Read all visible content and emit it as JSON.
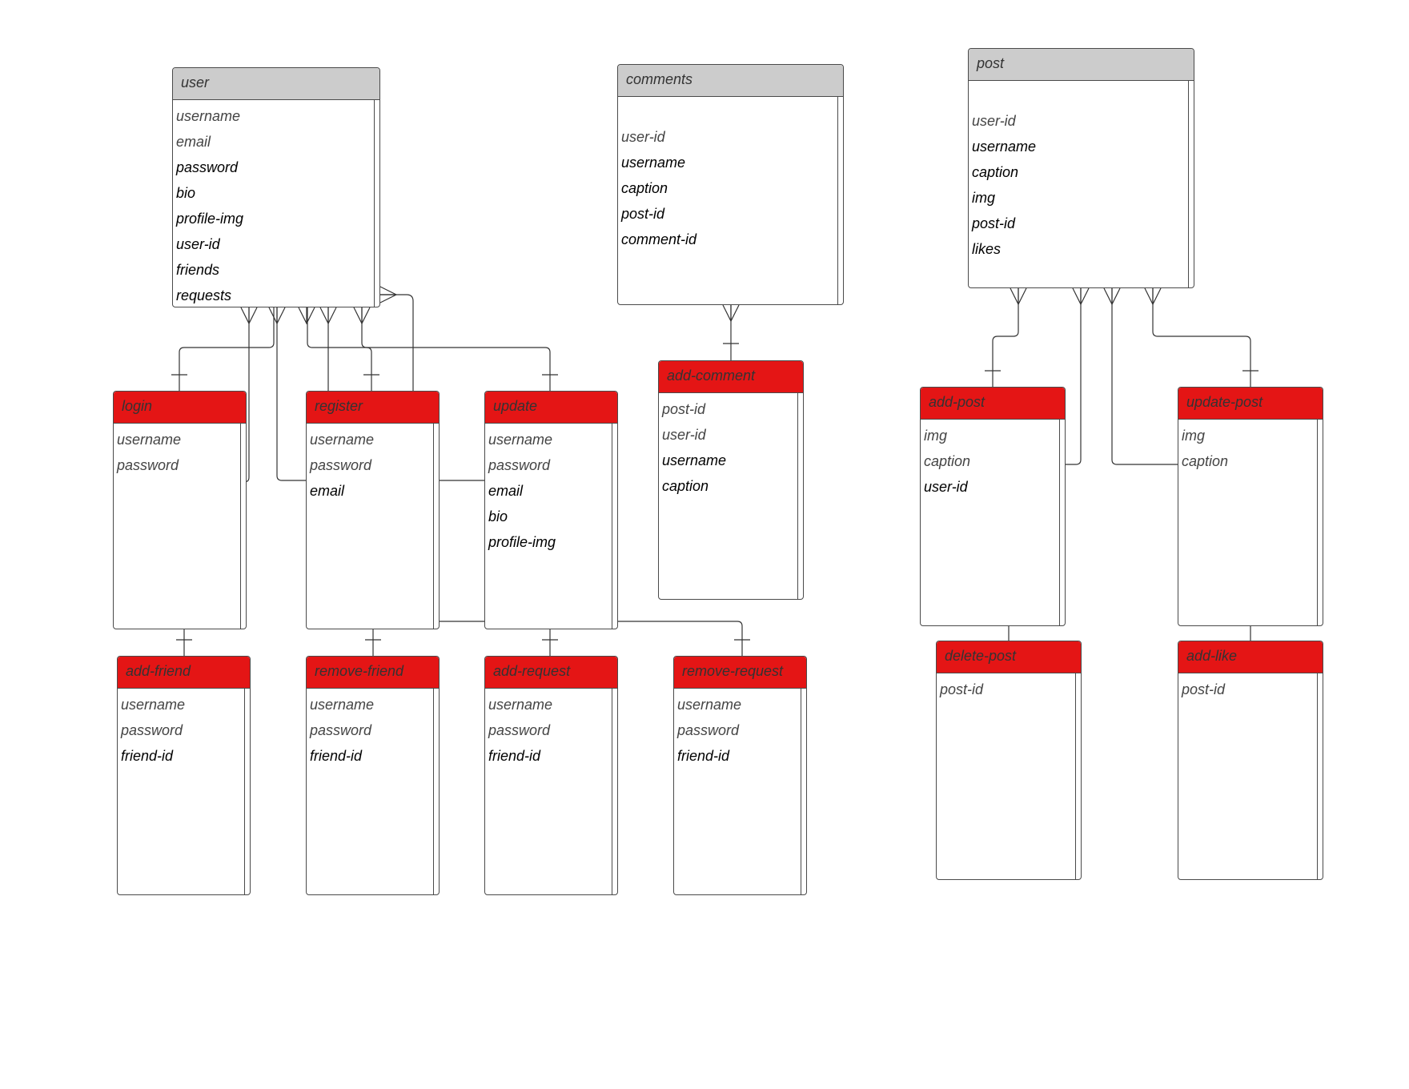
{
  "entities": {
    "user": {
      "title": "user",
      "fields": [
        "username",
        "email",
        "password",
        "bio",
        "profile-img",
        "user-id",
        "friends",
        "requests"
      ]
    },
    "comments": {
      "title": "comments",
      "fields": [
        "user-id",
        "username",
        "caption",
        "post-id",
        "comment-id"
      ]
    },
    "post": {
      "title": "post",
      "fields": [
        "user-id",
        "username",
        "caption",
        "img",
        "post-id",
        "likes"
      ]
    },
    "login": {
      "title": "login",
      "fields": [
        "username",
        "password"
      ]
    },
    "register": {
      "title": "register",
      "fields": [
        "username",
        "password",
        "email"
      ]
    },
    "update": {
      "title": "update",
      "fields": [
        "username",
        "password",
        "email",
        "bio",
        "profile-img"
      ]
    },
    "add_comment": {
      "title": "add-comment",
      "fields": [
        "post-id",
        "user-id",
        "username",
        "caption"
      ]
    },
    "add_post": {
      "title": "add-post",
      "fields": [
        "img",
        "caption",
        "user-id"
      ]
    },
    "update_post": {
      "title": "update-post",
      "fields": [
        "img",
        "caption"
      ]
    },
    "add_friend": {
      "title": "add-friend",
      "fields": [
        "username",
        "password",
        "friend-id"
      ]
    },
    "remove_friend": {
      "title": "remove-friend",
      "fields": [
        "username",
        "password",
        "friend-id"
      ]
    },
    "add_request": {
      "title": "add-request",
      "fields": [
        "username",
        "password",
        "friend-id"
      ]
    },
    "remove_request": {
      "title": "remove-request",
      "fields": [
        "username",
        "password",
        "friend-id"
      ]
    },
    "delete_post": {
      "title": "delete-post",
      "fields": [
        "post-id"
      ]
    },
    "add_like": {
      "title": "add-like",
      "fields": [
        "post-id"
      ]
    }
  },
  "relationships": [
    {
      "from": "user",
      "to": "login",
      "from_cardinality": "many",
      "to_cardinality": "one"
    },
    {
      "from": "user",
      "to": "register",
      "from_cardinality": "many",
      "to_cardinality": "one"
    },
    {
      "from": "user",
      "to": "update",
      "from_cardinality": "many",
      "to_cardinality": "one"
    },
    {
      "from": "user",
      "to": "add_friend",
      "from_cardinality": "many",
      "to_cardinality": "one"
    },
    {
      "from": "user",
      "to": "remove_friend",
      "from_cardinality": "many",
      "to_cardinality": "one"
    },
    {
      "from": "user",
      "to": "add_request",
      "from_cardinality": "many",
      "to_cardinality": "one"
    },
    {
      "from": "user",
      "to": "remove_request",
      "from_cardinality": "many",
      "to_cardinality": "one"
    },
    {
      "from": "comments",
      "to": "add_comment",
      "from_cardinality": "many",
      "to_cardinality": "one"
    },
    {
      "from": "post",
      "to": "add_post",
      "from_cardinality": "many",
      "to_cardinality": "one"
    },
    {
      "from": "post",
      "to": "update_post",
      "from_cardinality": "many",
      "to_cardinality": "one"
    },
    {
      "from": "post",
      "to": "delete_post",
      "from_cardinality": "many",
      "to_cardinality": "one"
    },
    {
      "from": "post",
      "to": "add_like",
      "from_cardinality": "many",
      "to_cardinality": "one"
    }
  ],
  "colors": {
    "header_grey": "#cccccc",
    "header_red": "#e41515",
    "border": "#4a4a4a",
    "line": "#333333"
  }
}
